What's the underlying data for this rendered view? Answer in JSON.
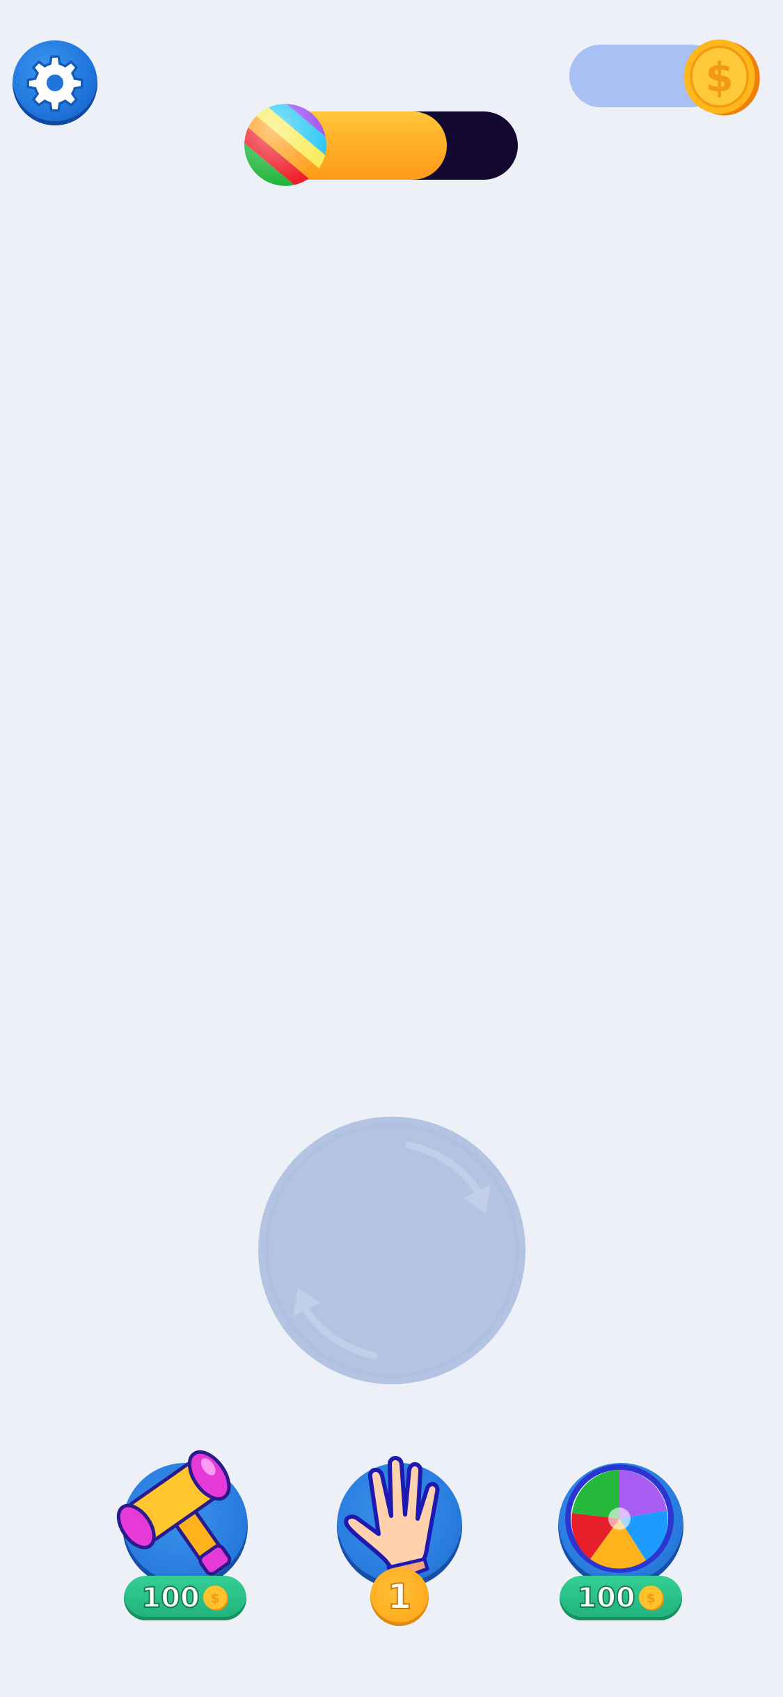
{
  "header": {
    "settings_icon": "gear-icon",
    "coin_icon": "coin-icon",
    "coin_count": "",
    "progress": {
      "fraction": 0.72,
      "icon": "rainbow-ball-icon"
    }
  },
  "board": {
    "rotate_icon": "rotate-arrows-icon"
  },
  "boosters": [
    {
      "name": "hammer",
      "icon": "hammer-icon",
      "price": "100"
    },
    {
      "name": "hand",
      "icon": "hand-icon",
      "count": "1"
    },
    {
      "name": "swirl",
      "icon": "swirl-icon",
      "price": "100"
    }
  ],
  "colors": {
    "background": "#edf1f7",
    "button_blue": "#2a7ddf",
    "progress_fill": "#ffae25",
    "progress_track": "#120830",
    "price_green": "#22b07a",
    "badge_orange": "#ffab1d",
    "coin_pill": "#a9c0f5",
    "rotate_circle": "#b3c3e2"
  }
}
